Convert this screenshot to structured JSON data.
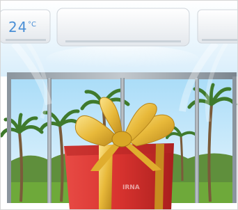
{
  "scene": {
    "ac_display": {
      "temperature": "24",
      "unit": "°C"
    },
    "watermark_text": "IRNA",
    "colors": {
      "sky": "#bfe6fb",
      "grass": "#6ea93a",
      "box_red": "#d8332f",
      "ribbon_gold": "#e8b93a",
      "ac_body": "#f6f8fa",
      "display_blue": "#4a8fd6"
    },
    "icons": [
      "air-conditioner",
      "window-frame",
      "palm-tree",
      "gift-box",
      "bow-ribbon"
    ]
  }
}
